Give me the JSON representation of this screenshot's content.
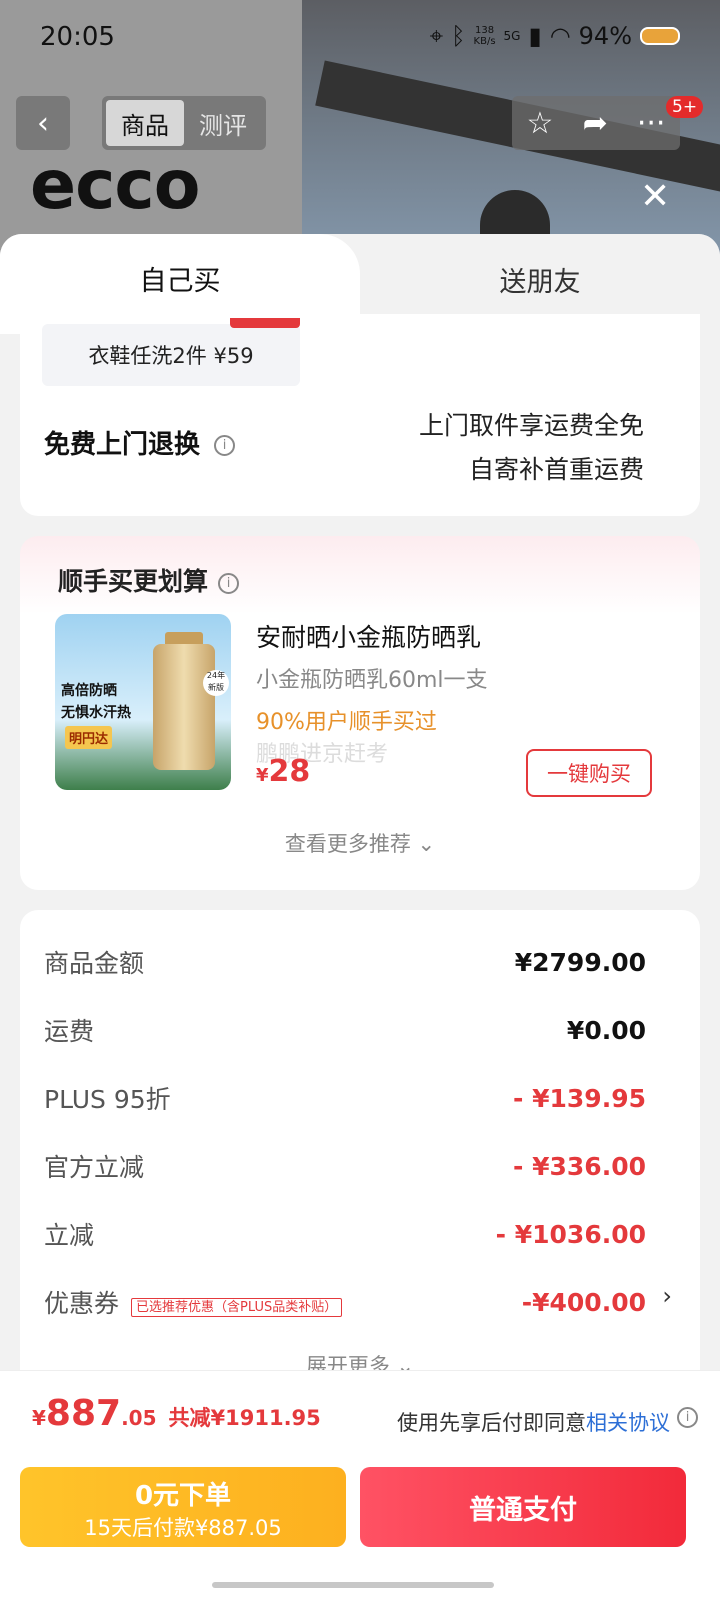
{
  "status_bar": {
    "time": "20:05",
    "network_speed": "138\nKB/s",
    "signal": "5G",
    "battery": "94%"
  },
  "header": {
    "brand_logo": "ecco",
    "tabs": [
      "商品",
      "测评"
    ],
    "active_tab": 0,
    "message_badge": "5+"
  },
  "sheet": {
    "tabs": {
      "self": "自己买",
      "gift": "送朋友"
    },
    "service": {
      "coupon_text": "衣鞋任洗2件 ¥59",
      "return_title": "免费上门退换",
      "return_line1": "上门取件享运费全免",
      "return_line2": "自寄补首重运费"
    },
    "recommend": {
      "title": "顺手买更划算",
      "image_text1": "高倍防晒",
      "image_text2": "无惧水汗热",
      "image_badge": "明円达",
      "image_new": "24年 新版",
      "product_name": "安耐晒小金瓶防晒乳",
      "product_sub": "小金瓶防晒乳60ml一支",
      "product_stat": "90%用户顺手买过",
      "watermark": "鹏鹏进京赶考",
      "price_symbol": "¥",
      "price": "28",
      "buy_button": "一键购买",
      "more": "查看更多推荐 ⌄"
    },
    "summary": {
      "rows": [
        {
          "label": "商品金额",
          "value": "¥2799.00"
        },
        {
          "label": "运费",
          "value": "¥0.00"
        },
        {
          "label": "PLUS 95折",
          "value": "- ¥139.95"
        },
        {
          "label": "官方立减",
          "value": "- ¥336.00"
        },
        {
          "label": "立减",
          "value": "- ¥1036.00"
        },
        {
          "label": "优惠券",
          "value": "-¥400.00"
        }
      ],
      "coupon_tag": "已选推荐优惠（含PLUS品类补贴）",
      "expand": "展开更多 ⌄"
    }
  },
  "footer": {
    "total_symbol": "¥",
    "total_int": "887",
    "total_dec": ".05",
    "total_saved": "共减¥1911.95",
    "agree_text": "使用先享后付即同意",
    "agree_link": "相关协议",
    "later_title": "0元下单",
    "later_sub": "15天后付款¥887.05",
    "pay_button": "普通支付"
  },
  "colors": {
    "accent_red": "#e4393c",
    "later_yellow": "#ffc42a",
    "link_blue": "#2d6fd6"
  }
}
